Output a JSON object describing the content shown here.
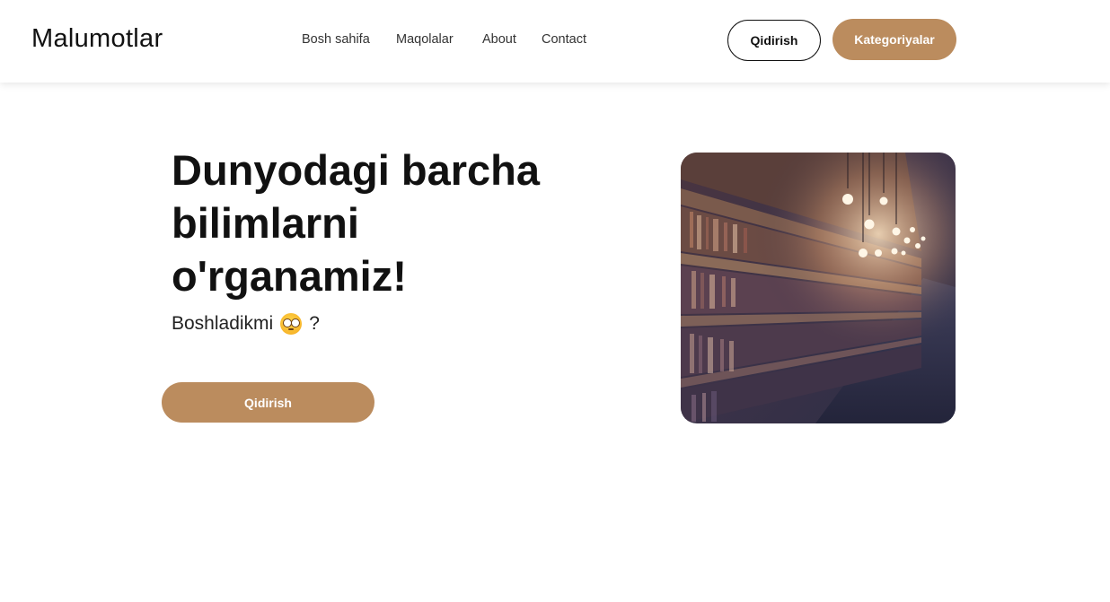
{
  "header": {
    "logo": "Malumotlar",
    "nav": [
      {
        "label": "Bosh sahifa"
      },
      {
        "label": "Maqolalar"
      },
      {
        "label": "About"
      },
      {
        "label": "Contact"
      }
    ],
    "search_button": "Qidirish",
    "categories_button": "Kategoriyalar"
  },
  "hero": {
    "title": "Dunyodagi barcha bilimlarni o'rganamiz!",
    "subtitle": "Boshladikmi",
    "subtitle_suffix": "?",
    "subtitle_icon": "flushed-face-emoji",
    "cta_label": "Qidirish",
    "image_icon": "library-bookshelves-photo"
  },
  "colors": {
    "accent": "#bb8c5e",
    "text": "#111111",
    "background": "#ffffff"
  }
}
